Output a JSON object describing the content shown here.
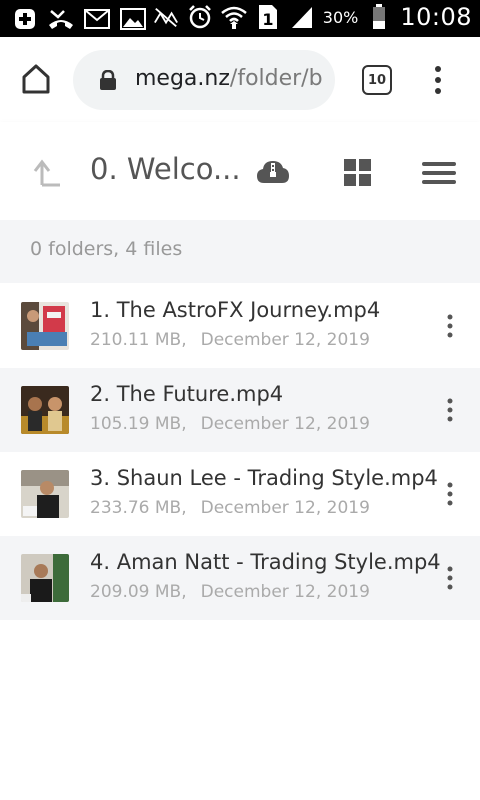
{
  "status_bar": {
    "battery_percent": "30%",
    "time": "10:08",
    "sim_slot": "1"
  },
  "browser": {
    "url_host": "mega.nz",
    "url_path": "/folder/b",
    "tab_count": "10"
  },
  "header": {
    "folder_title": "0. Welco..."
  },
  "summary": "0 folders, 4 files",
  "files": [
    {
      "name": "1. The AstroFX Journey.mp4",
      "size": "210.11 MB,",
      "date": "December 12, 2019"
    },
    {
      "name": "2. The Future.mp4",
      "size": "105.19 MB,",
      "date": "December 12, 2019"
    },
    {
      "name": "3. Shaun Lee - Trading Style.mp4",
      "size": "233.76 MB,",
      "date": "December 12, 2019"
    },
    {
      "name": "4. Aman Natt - Trading Style.mp4",
      "size": "209.09 MB,",
      "date": "December 12, 2019"
    }
  ],
  "icons": {
    "status": [
      "plus-square-icon",
      "missed-call-icon",
      "mail-icon",
      "image-icon",
      "mute-icon",
      "alarm-icon",
      "wifi-icon",
      "sim-icon",
      "signal-icon",
      "battery-icon"
    ],
    "browser": [
      "home-icon",
      "lock-icon",
      "tabs-icon",
      "menu-dots-icon"
    ],
    "header": [
      "up-arrow-icon",
      "cloud-zip-icon",
      "grid-view-icon",
      "hamburger-icon"
    ]
  },
  "colors": {
    "status_bar_bg": "#000000",
    "url_bar_bg": "#f1f3f4",
    "row_alt_bg": "#f4f5f7",
    "text_primary": "#333333",
    "text_muted": "#aaaaaa"
  }
}
